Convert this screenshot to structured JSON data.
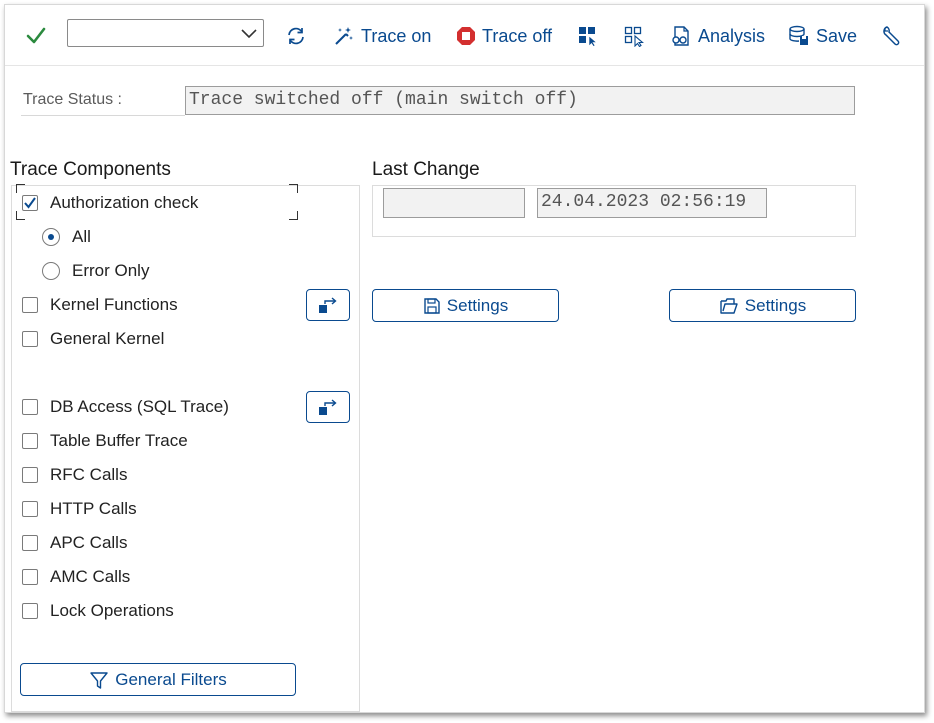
{
  "toolbar": {
    "combo_value": "",
    "trace_on_label": "Trace on",
    "trace_off_label": "Trace off",
    "analysis_label": "Analysis",
    "save_label": "Save"
  },
  "status": {
    "label": "Trace Status :",
    "value": "Trace switched off (main switch off)"
  },
  "trace_components": {
    "title": "Trace Components",
    "authorization_check": {
      "label": "Authorization check",
      "checked": true
    },
    "auth_options": [
      {
        "label": "All",
        "selected": true
      },
      {
        "label": "Error Only",
        "selected": false
      }
    ],
    "items": [
      {
        "label": "Kernel Functions",
        "checked": false
      },
      {
        "label": "General Kernel",
        "checked": false
      },
      {
        "label": "DB Access (SQL Trace)",
        "checked": false
      },
      {
        "label": "Table Buffer Trace",
        "checked": false
      },
      {
        "label": "RFC Calls",
        "checked": false
      },
      {
        "label": "HTTP Calls",
        "checked": false
      },
      {
        "label": "APC Calls",
        "checked": false
      },
      {
        "label": "AMC Calls",
        "checked": false
      },
      {
        "label": "Lock Operations",
        "checked": false
      }
    ],
    "general_filters_label": "General Filters"
  },
  "last_change": {
    "title": "Last Change",
    "user": "",
    "timestamp": "24.04.2023 02:56:19"
  },
  "settings_buttons": {
    "save_settings_label": "Settings",
    "load_settings_label": "Settings"
  },
  "colors": {
    "accent": "#0a4a8f",
    "check_green": "#2b8a3e",
    "trace_off_red": "#d32f2f"
  }
}
